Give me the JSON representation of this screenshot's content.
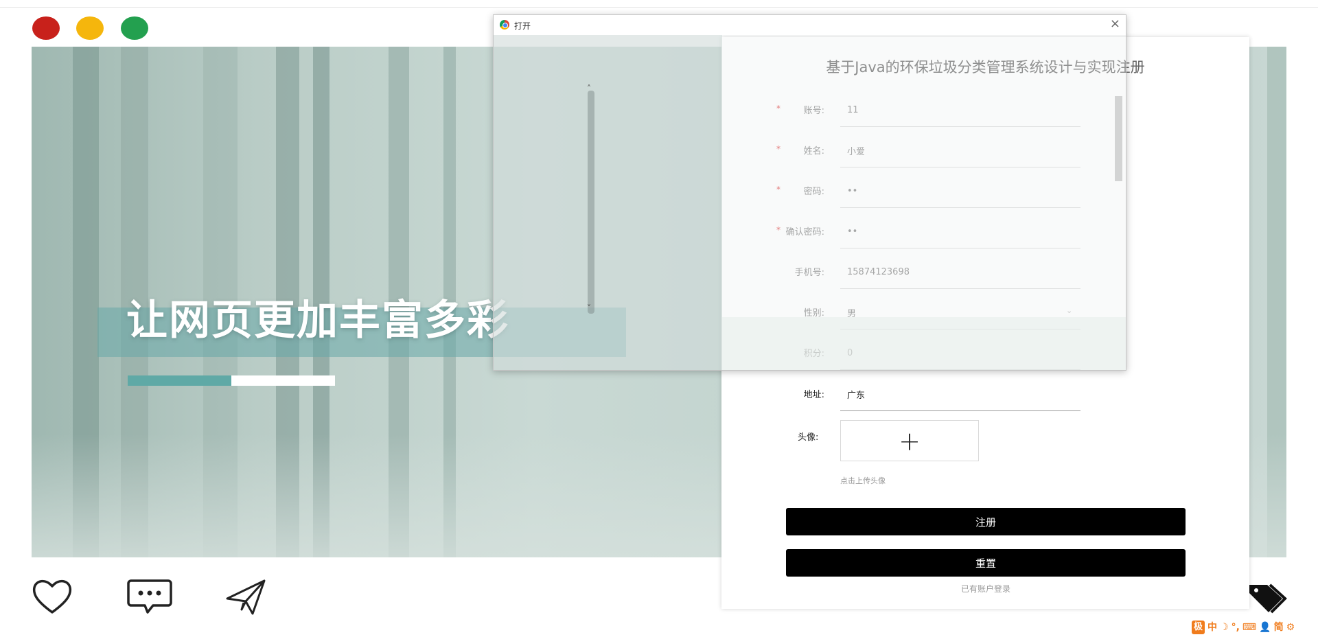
{
  "hero": {
    "title": "让网页更加丰富多彩",
    "progress_fraction": 0.5
  },
  "dialog": {
    "title": "打开",
    "close": "×"
  },
  "register": {
    "title": "基于Java的环保垃圾分类管理系统设计与实现注册",
    "fields": [
      {
        "label": "账号:",
        "value": "11",
        "required": true
      },
      {
        "label": "姓名:",
        "value": "小爱",
        "required": true
      },
      {
        "label": "密码:",
        "value": "••",
        "required": true
      },
      {
        "label": "确认密码:",
        "value": "••",
        "required": true
      },
      {
        "label": "手机号:",
        "value": "15874123698",
        "required": false
      },
      {
        "label": "性别:",
        "value": "男",
        "required": false
      },
      {
        "label": "积分:",
        "value": "0",
        "required": false
      },
      {
        "label": "地址:",
        "value": "广东",
        "required": false
      }
    ],
    "required_mark": "*",
    "avatar_label": "头像:",
    "avatar_plus": "+",
    "avatar_hint": "点击上传头像",
    "submit_label": "注册",
    "reset_label": "重置",
    "login_link": "已有账户登录"
  },
  "ime": {
    "logo": "极",
    "lang": "中",
    "moon": "☽",
    "dots": "°,",
    "keyboard": "⌨",
    "user": "👤",
    "simplified": "简",
    "settings": "⚙"
  },
  "colors": {
    "red_dot": "#c8211b",
    "yellow_dot": "#f5b60c",
    "green_dot": "#23a04f",
    "accent_teal": "#5fa9a6",
    "button": "#000000"
  }
}
